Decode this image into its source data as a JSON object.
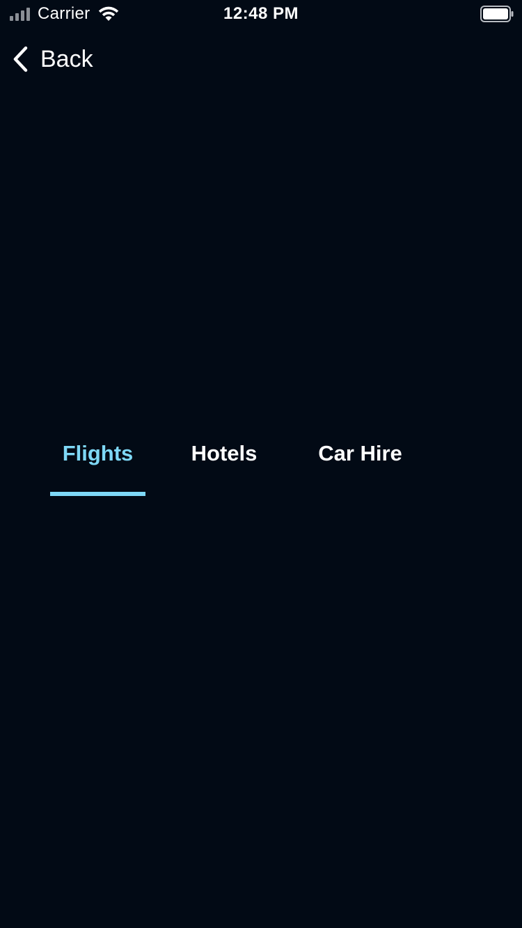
{
  "status_bar": {
    "carrier": "Carrier",
    "time": "12:48 PM",
    "signal_icon": "signal-icon",
    "wifi_icon": "wifi-icon",
    "battery_icon": "battery-icon"
  },
  "nav": {
    "back_label": "Back",
    "back_icon": "chevron-left-icon"
  },
  "tabs": [
    {
      "label": "Flights",
      "active": true
    },
    {
      "label": "Hotels",
      "active": false
    },
    {
      "label": "Car Hire",
      "active": false
    }
  ],
  "colors": {
    "background": "#020a15",
    "accent": "#7ed8f6",
    "text": "#ffffff"
  }
}
